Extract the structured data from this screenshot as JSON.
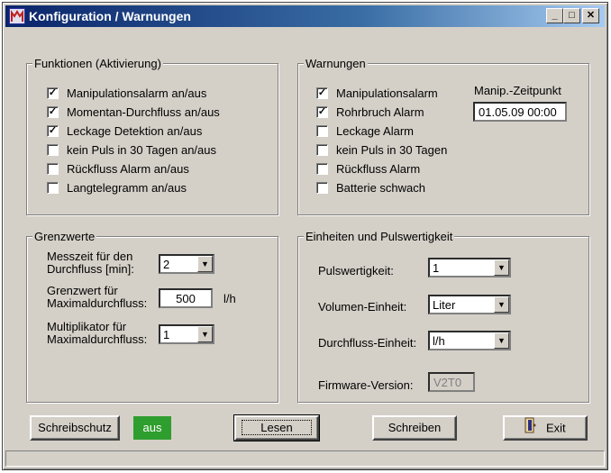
{
  "window": {
    "title": "Konfiguration / Warnungen",
    "minimize": "_",
    "maximize": "□",
    "close": "✕"
  },
  "funktionen": {
    "legend": "Funktionen (Aktivierung)",
    "items": [
      {
        "label": "Manipulationsalarm an/aus",
        "checked": true
      },
      {
        "label": "Momentan-Durchfluss an/aus",
        "checked": true
      },
      {
        "label": "Leckage Detektion an/aus",
        "checked": true
      },
      {
        "label": "kein Puls in 30 Tagen an/aus",
        "checked": false
      },
      {
        "label": "Rückfluss Alarm an/aus",
        "checked": false
      },
      {
        "label": "Langtelegramm an/aus",
        "checked": false
      }
    ]
  },
  "warnungen": {
    "legend": "Warnungen",
    "items": [
      {
        "label": "Manipulationsalarm",
        "checked": true
      },
      {
        "label": "Rohrbruch Alarm",
        "checked": true
      },
      {
        "label": "Leckage Alarm",
        "checked": false
      },
      {
        "label": "kein Puls in 30 Tagen",
        "checked": false
      },
      {
        "label": "Rückfluss Alarm",
        "checked": false
      },
      {
        "label": "Batterie schwach",
        "checked": false
      }
    ],
    "manip_label": "Manip.-Zeitpunkt",
    "manip_value": "01.05.09 00:00"
  },
  "grenzwerte": {
    "legend": "Grenzwerte",
    "messzeit_label_1": "Messzeit für den",
    "messzeit_label_2": "Durchfluss [min]:",
    "messzeit_value": "2",
    "grenzwert_label_1": "Grenzwert für",
    "grenzwert_label_2": "Maximaldurchfluss:",
    "grenzwert_value": "500",
    "grenzwert_unit": "l/h",
    "multiplikator_label_1": "Multiplikator für",
    "multiplikator_label_2": "Maximaldurchfluss:",
    "multiplikator_value": "1"
  },
  "einheiten": {
    "legend": "Einheiten und Pulswertigkeit",
    "puls_label": "Pulswertigkeit:",
    "puls_value": "1",
    "volumen_label": "Volumen-Einheit:",
    "volumen_value": "Liter",
    "durchfluss_label": "Durchfluss-Einheit:",
    "durchfluss_value": "l/h",
    "firmware_label": "Firmware-Version:",
    "firmware_value": "V2T0"
  },
  "buttons": {
    "schreibschutz": "Schreibschutz",
    "status": "aus",
    "lesen": "Lesen",
    "schreiben": "Schreiben",
    "exit": "Exit"
  },
  "colors": {
    "status_green": "#2e9e2e",
    "titlebar": "#0a246a"
  }
}
